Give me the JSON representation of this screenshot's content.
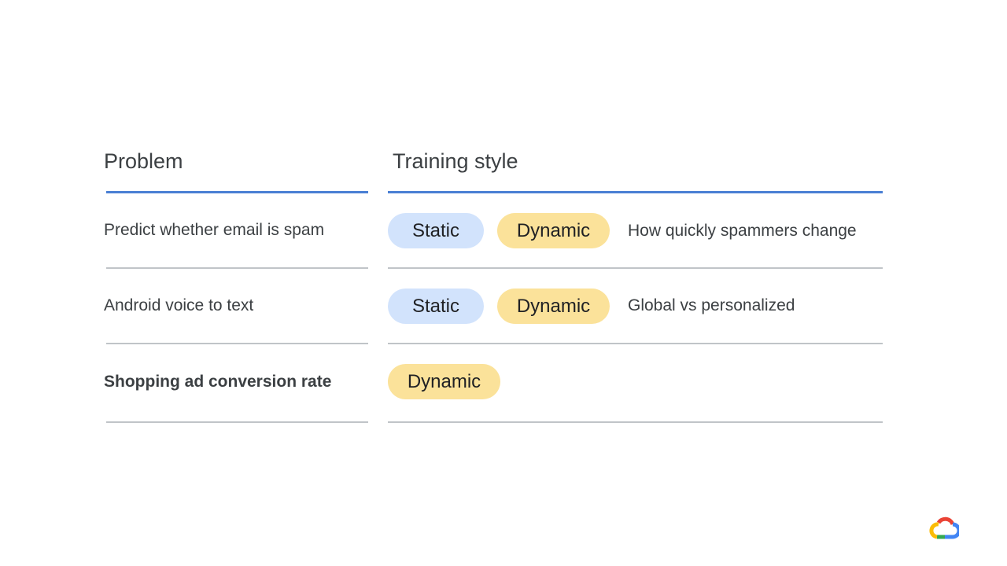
{
  "headers": {
    "problem": "Problem",
    "training_style": "Training style"
  },
  "rows": [
    {
      "problem": "Predict whether email is spam",
      "chips": [
        "Static",
        "Dynamic"
      ],
      "note": "How quickly spammers change"
    },
    {
      "problem": "Android voice to text",
      "chips": [
        "Static",
        "Dynamic"
      ],
      "note": "Global vs personalized"
    },
    {
      "problem": "Shopping ad conversion rate",
      "chips": [
        "Dynamic"
      ],
      "note": ""
    }
  ],
  "colors": {
    "accent_line": "#4a7fd4",
    "static_chip": "#d2e3fc",
    "dynamic_chip": "#fbe29a"
  },
  "logo": "google-cloud-logo"
}
